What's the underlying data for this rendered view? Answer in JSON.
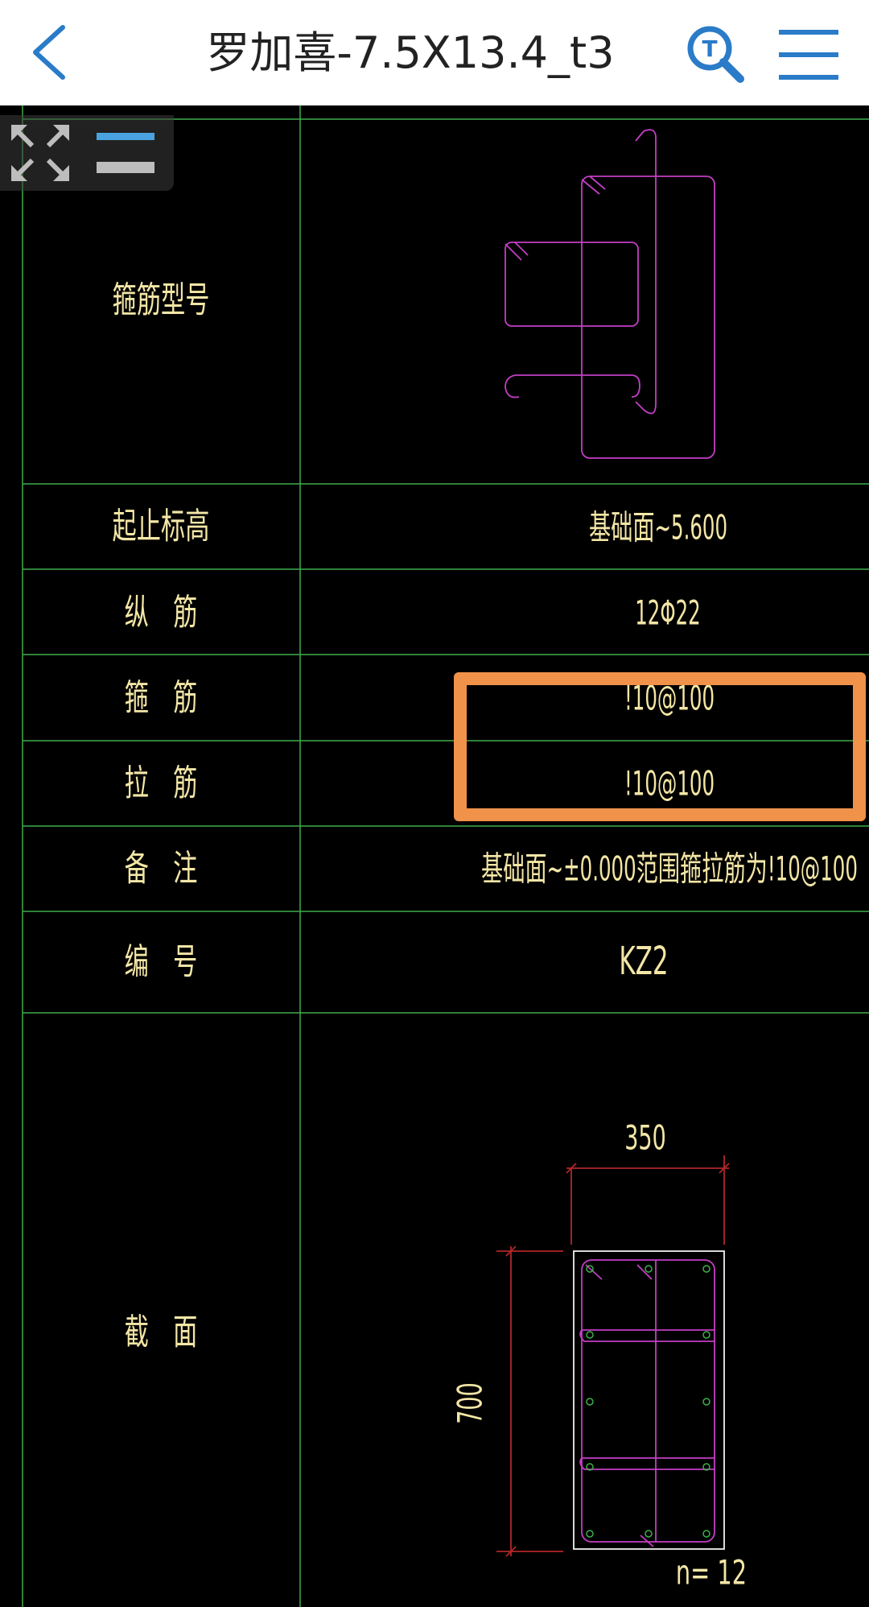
{
  "header": {
    "back_icon": "chevron-left-icon",
    "title": "罗加喜-7.5X13.4_t3",
    "search_icon": "text-search-icon",
    "menu_icon": "hamburger-menu-icon"
  },
  "toolbar": {
    "fit_icon": "fit-screen-icon",
    "layers_icon": "layers-icon"
  },
  "table": {
    "rows": [
      {
        "label": "箍筋型号",
        "value": ""
      },
      {
        "label": "起止标高",
        "value": "基础面~5.600"
      },
      {
        "label": "纵　筋",
        "value": "12Φ22"
      },
      {
        "label": "箍　筋",
        "value": "!10@100"
      },
      {
        "label": "拉　筋",
        "value": "!10@100"
      },
      {
        "label": "备　注",
        "value": "基础面~±0.000范围箍拉筋为!10@100"
      },
      {
        "label": "编　号",
        "value": "KZ2"
      },
      {
        "label": "截　面",
        "value": ""
      }
    ]
  },
  "section": {
    "width_dim": "350",
    "height_dim": "700",
    "bar_count": "n= 12"
  },
  "colors": {
    "grid": "#3fae4a",
    "rebar": "#c23fc4",
    "dimension": "#b3262a",
    "text": "#f3e6a6",
    "highlight": "#f0924a",
    "accent": "#2a7bc8"
  }
}
